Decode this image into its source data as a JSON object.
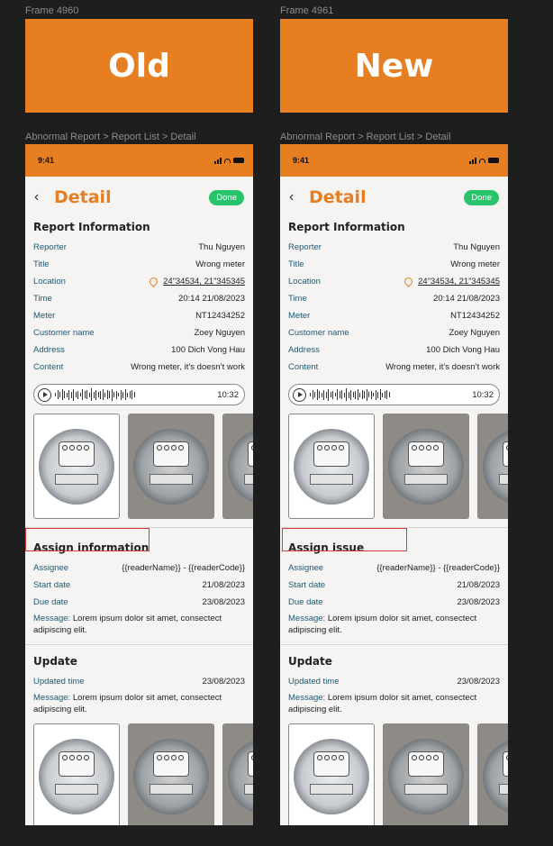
{
  "frames": [
    {
      "id": "old",
      "frame_label": "Frame 4960",
      "banner": "Old",
      "assign_title": "Assign information"
    },
    {
      "id": "new",
      "frame_label": "Frame 4961",
      "banner": "New",
      "assign_title": "Assign issue"
    }
  ],
  "breadcrumb": "Abnormal Report > Report List > Detail",
  "status_time": "9:41",
  "header": {
    "back_icon": "chevron-left-icon",
    "title": "Detail",
    "badge": "Done"
  },
  "report": {
    "title": "Report Information",
    "rows": [
      {
        "k": "Reporter",
        "v": "Thu Nguyen"
      },
      {
        "k": "Title",
        "v": "Wrong meter"
      },
      {
        "k": "Location",
        "v": "24”34534, 21”345345"
      },
      {
        "k": "Time",
        "v": "20:14 21/08/2023"
      },
      {
        "k": "Meter",
        "v": "NT12434252"
      },
      {
        "k": "Customer name",
        "v": "Zoey Nguyen"
      },
      {
        "k": "Address",
        "v": "100 Dich Vong Hau"
      },
      {
        "k": "Content",
        "v": "Wrong meter, it’s doesn’t work"
      }
    ],
    "audio_time": "10:32"
  },
  "assign": {
    "rows": [
      {
        "k": "Assignee",
        "v": "{{readerName}} - {{readerCode}}"
      },
      {
        "k": "Start date",
        "v": "21/08/2023"
      },
      {
        "k": "Due date",
        "v": "23/08/2023"
      }
    ],
    "message_label": "Message:",
    "message_text": " Lorem ipsum dolor sit amet, consectect adipiscing elit."
  },
  "update": {
    "title": "Update",
    "rows": [
      {
        "k": "Updated time",
        "v": "23/08/2023"
      }
    ],
    "message_label": "Message:",
    "message_text": " Lorem ipsum dolor sit amet, consectect adipiscing elit."
  },
  "colors": {
    "accent": "#e67e22",
    "done": "#27c46b",
    "label": "#1c5a78",
    "highlight": "#d83b3b"
  }
}
